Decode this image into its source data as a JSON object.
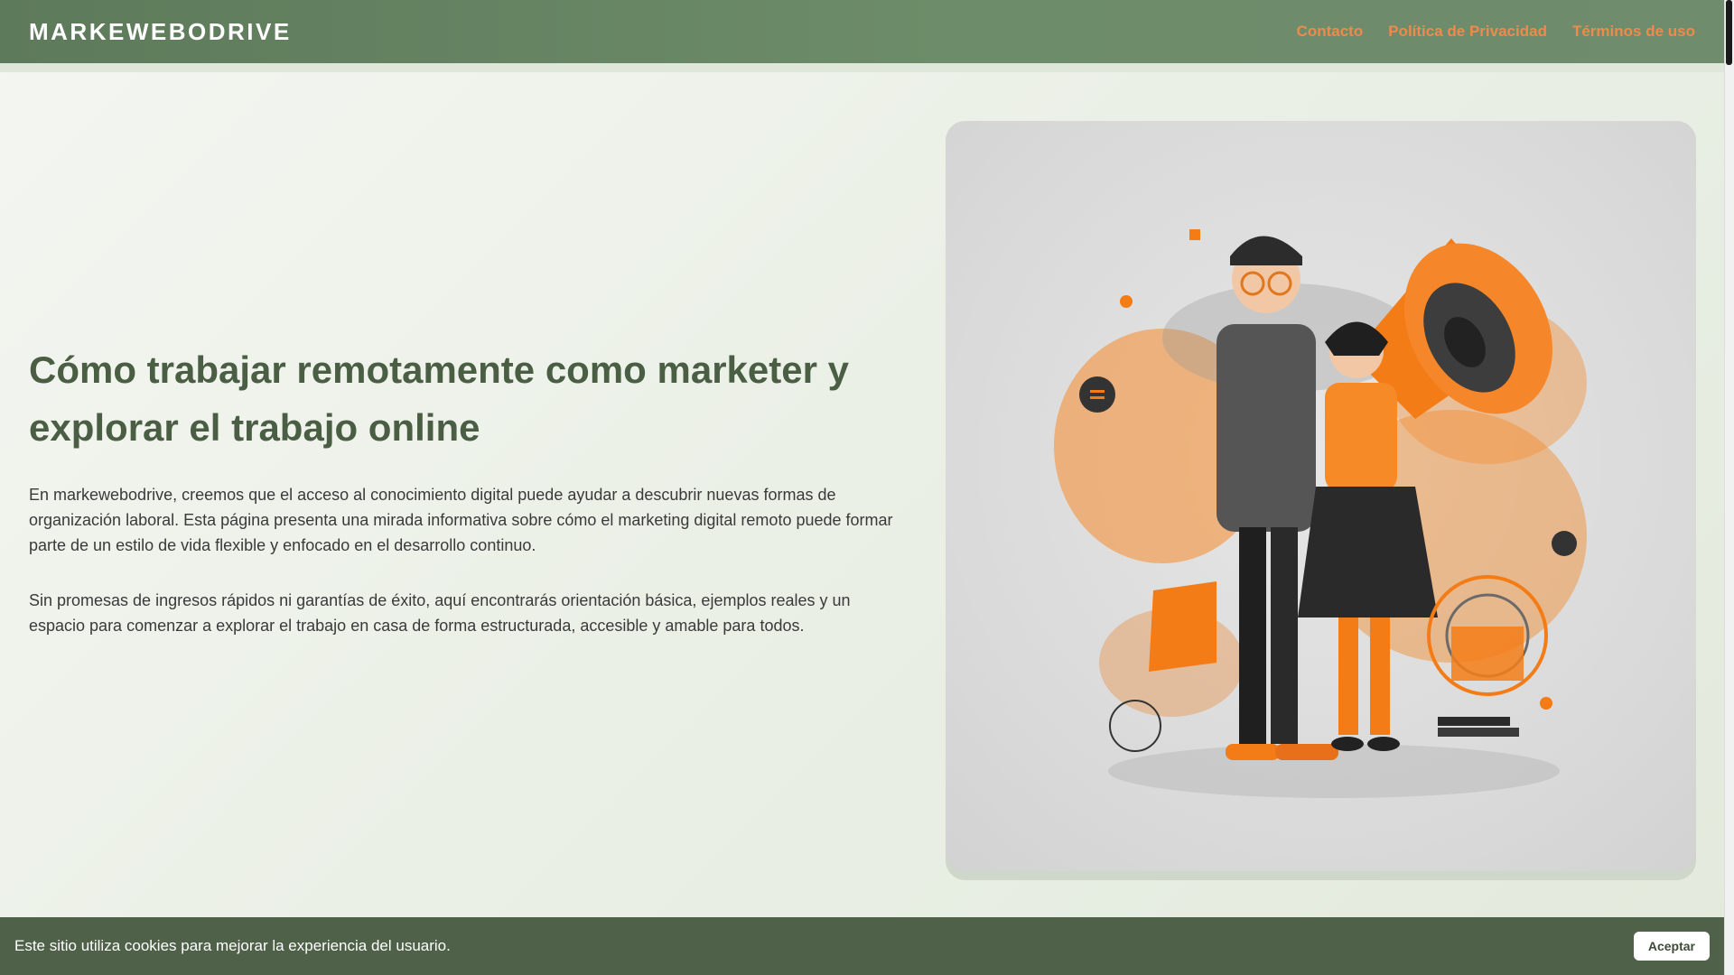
{
  "header": {
    "brand": "MARKEWEBODRIVE",
    "nav": [
      "Contacto",
      "Política de Privacidad",
      "Términos de uso"
    ],
    "background": "#6d8c69",
    "link_color": "#f08a4b"
  },
  "hero": {
    "title": "Cómo trabajar remotamente como marketer y explorar el trabajo online",
    "paragraphs": [
      "En markewebodrive, creemos que el acceso al conocimiento digital puede ayudar a descubrir nuevas formas de organización laboral. Esta página presenta una mirada informativa sobre cómo el marketing digital remoto puede formar parte de un estilo de vida flexible y enfocado en el desarrollo continuo.",
      "Sin promesas de ingresos rápidos ni garantías de éxito, aquí encontrarás orientación básica, ejemplos reales y un espacio para comenzar a explorar el trabajo en casa de forma estructurada, accesible y amable para todos."
    ],
    "title_color": "#4a5e44",
    "image_accent": "#f47c16"
  },
  "cookie_banner": {
    "text": "Este sitio utiliza cookies para mejorar la experiencia del usuario.",
    "button_label": "Aceptar",
    "background": "#4f6148"
  }
}
